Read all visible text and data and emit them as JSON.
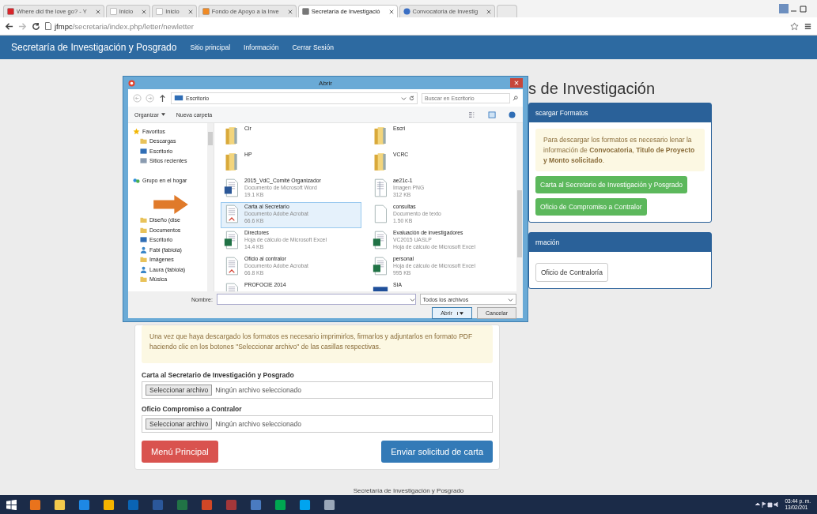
{
  "browser": {
    "tabs": [
      {
        "title": "Where did the love go? - Y",
        "kind": "video",
        "selected": false
      },
      {
        "title": "Inicio",
        "kind": "page",
        "selected": false
      },
      {
        "title": "Inicio",
        "kind": "page",
        "selected": false
      },
      {
        "title": "Fondo de Apoyo a la Inve",
        "kind": "site",
        "selected": false
      },
      {
        "title": "Secretaría de Investigació",
        "kind": "building",
        "selected": true
      },
      {
        "title": "Convocatoria de Investig",
        "kind": "globe",
        "selected": false
      }
    ],
    "address": {
      "host": "jfmpc",
      "path": "/secretaria/index.php/letter/newletter"
    }
  },
  "navbar": {
    "brand": "Secretaría de Investigación y Posgrado",
    "links": [
      "Sitio principal",
      "Información",
      "Cerrar Sesión"
    ]
  },
  "page": {
    "heading": "s de Investigación",
    "formats_panel": {
      "title": "scargar Formatos",
      "alert": "Para descargar los formatos es necesario lenar la información de **Convocatoria**, **Titulo de Proyecto y Monto solicitado**.",
      "buttons": [
        "Carta al Secretario de Investigación y Posgrado",
        "Oficio de Compromiso a Contralor"
      ]
    },
    "info_panel": {
      "title": "rmación",
      "buttons": [
        "Oficio de Contraloría"
      ]
    },
    "form": {
      "alert": "Una vez que haya descargado los formatos es necesario imprimirlos, firmarlos y adjuntarlos en formato PDF haciendo clic en los botones \"Seleccionar archivo\" de las casillas respectivas.",
      "fields": [
        {
          "label": "Carta al Secretario de Investigación y Posgrado",
          "button": "Seleccionar archivo",
          "status": "Ningún archivo seleccionado"
        },
        {
          "label": "Oficio Compromiso a Contralor",
          "button": "Seleccionar archivo",
          "status": "Ningún archivo seleccionado"
        }
      ],
      "buttons": [
        {
          "label": "Menú Principal",
          "kind": "danger"
        },
        {
          "label": "Enviar solicitud de carta",
          "kind": "primary"
        }
      ]
    },
    "footer": "Secretaría de Investigación y Posgrado"
  },
  "dialog": {
    "title": "Abrir",
    "location": "Escritorio",
    "search": {
      "placeholder": "Buscar en Escritorio"
    },
    "toolbar": [
      "Organizar",
      "Nueva carpeta"
    ],
    "nav": [
      {
        "label": "Favoritos",
        "kind": "star",
        "children": [
          {
            "label": "Descargas",
            "kind": "folder"
          },
          {
            "label": "Escritorio",
            "kind": "desktop"
          },
          {
            "label": "Sitios recientes",
            "kind": "recent"
          }
        ]
      },
      {
        "label": "Grupo en el hogar",
        "kind": "homegroup"
      },
      {
        "children": [
          {
            "label": "Diseño (dise",
            "kind": "folder"
          },
          {
            "label": "Documentos",
            "kind": "folder"
          },
          {
            "label": "Escritorio",
            "kind": "desktop"
          },
          {
            "label": "Fabi (fabiola)",
            "kind": "user"
          },
          {
            "label": "Imágenes",
            "kind": "folder"
          },
          {
            "label": "Laura (fabiola)",
            "kind": "user"
          },
          {
            "label": "Música",
            "kind": "folder"
          }
        ]
      }
    ],
    "files": [
      {
        "name": "Cir",
        "kind": "folder",
        "selected": false
      },
      {
        "name": "Escri",
        "kind": "folder",
        "selected": false
      },
      {
        "name": "HP",
        "kind": "folder",
        "selected": false
      },
      {
        "name": "VCRC",
        "kind": "folder",
        "selected": false
      },
      {
        "name": "2015_VdC_Comité Organizador",
        "details": [
          "Documento de Microsoft Word",
          "19.1 KB"
        ],
        "kind": "word",
        "selected": false
      },
      {
        "name": "ae21c-1",
        "details": [
          "Imagen PNG",
          "312 KB"
        ],
        "kind": "png",
        "selected": false
      },
      {
        "name": "Carta al Secretario",
        "details": [
          "Documento Adobe Acrobat",
          "66.6 KB"
        ],
        "kind": "pdf",
        "selected": true
      },
      {
        "name": "consultas",
        "details": [
          "Documento de texto",
          "1.50 KB"
        ],
        "kind": "text",
        "selected": false
      },
      {
        "name": "Directores",
        "details": [
          "Hoja de cálculo de Microsoft Excel",
          "14.4 KB"
        ],
        "kind": "excel",
        "selected": false
      },
      {
        "name": "Evaluación de investigadores",
        "details": [
          "VC2015 UASLP",
          "Hoja de cálculo de Microsoft Excel"
        ],
        "kind": "excel",
        "selected": false
      },
      {
        "name": "Oficio al contralor",
        "details": [
          "Documento Adobe Acrobat",
          "66.8 KB"
        ],
        "kind": "pdf",
        "selected": false
      },
      {
        "name": "personal",
        "details": [
          "Hoja de cálculo de Microsoft Excel",
          "995 KB"
        ],
        "kind": "excel",
        "selected": false
      },
      {
        "name": "PROFOCIE 2014",
        "kind": "pdf",
        "selected": false
      },
      {
        "name": "SIA",
        "kind": "banner",
        "selected": false
      }
    ],
    "filename_label": "Nombre:",
    "filetype": "Todos los archivos",
    "buttons": [
      "Abrir",
      "Cancelar"
    ]
  },
  "taskbar": {
    "time": "03:44 p. m.",
    "date": "13/02/201"
  }
}
